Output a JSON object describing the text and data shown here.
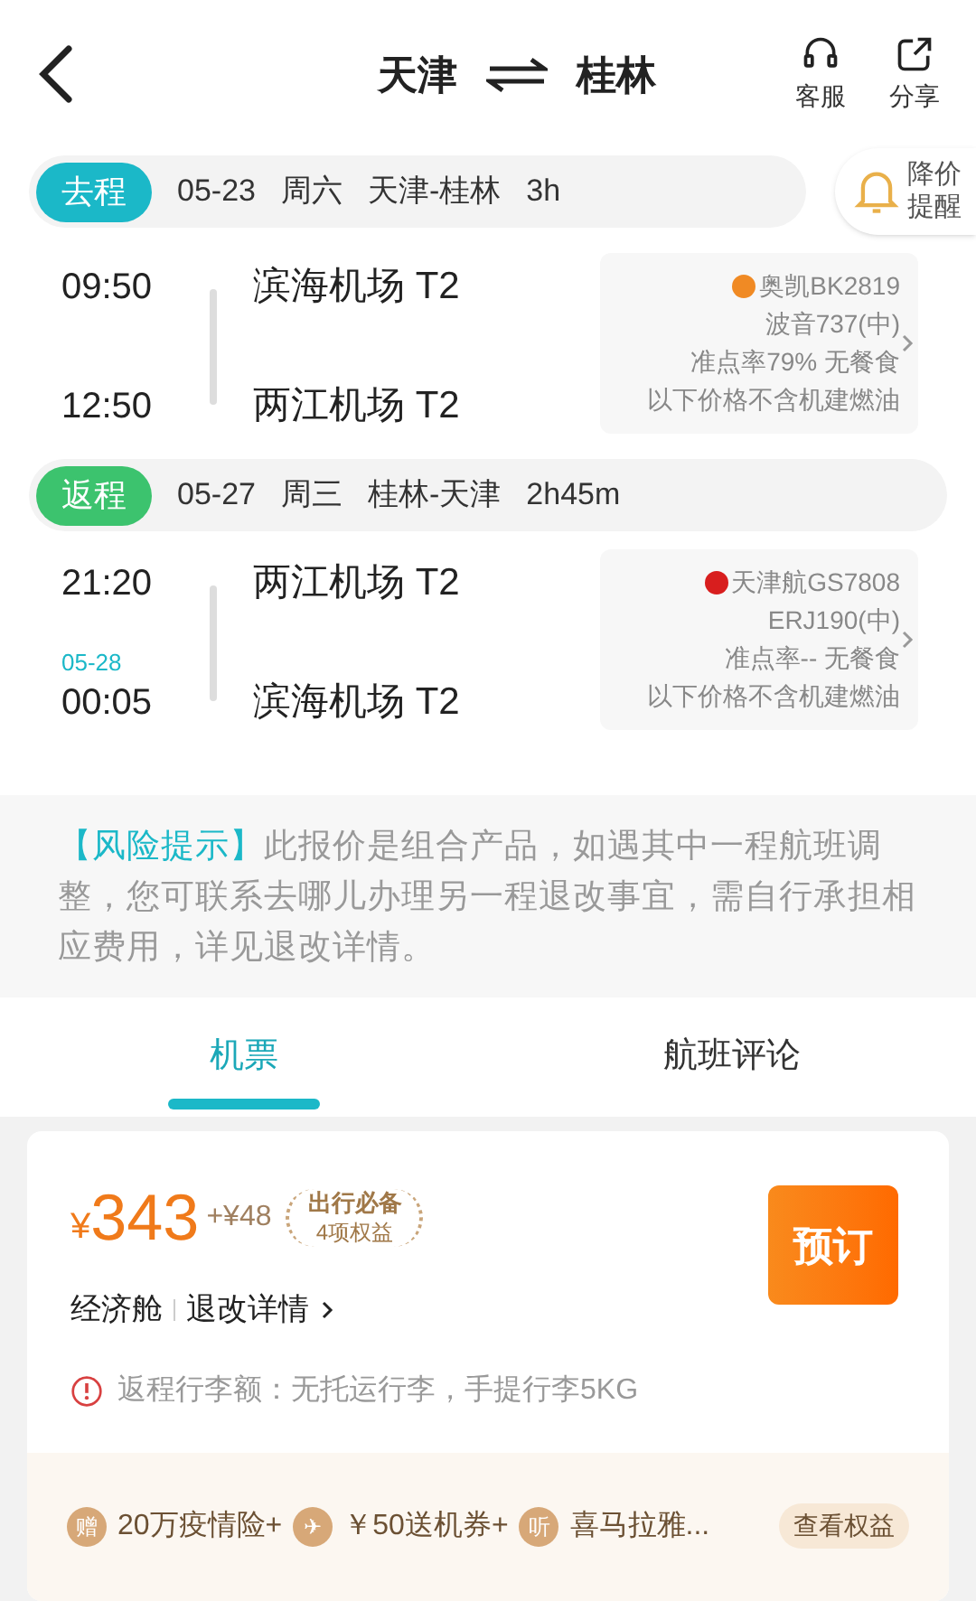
{
  "header": {
    "origin": "天津",
    "destination": "桂林",
    "actions": [
      {
        "kind": "service",
        "label": "客服"
      },
      {
        "kind": "share",
        "label": "分享"
      }
    ]
  },
  "price_alert": {
    "label": "降价",
    "label2": "提醒"
  },
  "legs": [
    {
      "tag": "去程",
      "color": "#1bb8c8",
      "date": "05-23",
      "weekday": "周六",
      "route": "天津-桂林",
      "duration": "3h",
      "depart_time": "09:50",
      "depart_airport": "滨海机场 T2",
      "arrive_time": "12:50",
      "arrive_airport": "两江机场 T2",
      "flight": {
        "color": "#f08a24",
        "number": "奥凯BK2819",
        "aircraft": "波音737(中)",
        "punctuality": "准点率79% 无餐食",
        "note": "以下价格不含机建燃油"
      }
    },
    {
      "tag": "返程",
      "color": "#3cc36e",
      "date": "05-27",
      "weekday": "周三",
      "route": "桂林-天津",
      "duration": "2h45m",
      "depart_time": "21:20",
      "depart_airport": "两江机场 T2",
      "arrive_date": "05-28",
      "arrive_time": "00:05",
      "arrive_airport": "滨海机场 T2",
      "flight": {
        "color": "#d81e1e",
        "number": "天津航GS7808",
        "aircraft": "ERJ190(中)",
        "punctuality": "准点率-- 无餐食",
        "note": "以下价格不含机建燃油"
      }
    }
  ],
  "risk_notice": {
    "title": "【风险提示】",
    "text": "此报价是组合产品，如遇其中一程航班调整，您可联系去哪儿办理另一程退改事宜，需自行承担相应费用，详见退改详情。"
  },
  "tabs": [
    {
      "label": "机票",
      "selected": true
    },
    {
      "label": "航班评论",
      "selected": false
    }
  ],
  "offer": {
    "currency": "¥",
    "price": "343",
    "extra": "+¥48",
    "perk_title": "出行必备",
    "perk_sub": "4项权益",
    "book": "预订",
    "cabin": "经济舱",
    "refund": "退改详情",
    "baggage": "返程行李额：无托运行李，手提行李5KG",
    "benefits": [
      {
        "icon": "赠",
        "text": "20万疫情险+"
      },
      {
        "icon": "✈",
        "text": "￥50送机券+"
      },
      {
        "icon": "听",
        "text": "喜马拉雅..."
      }
    ],
    "view": "查看权益"
  }
}
